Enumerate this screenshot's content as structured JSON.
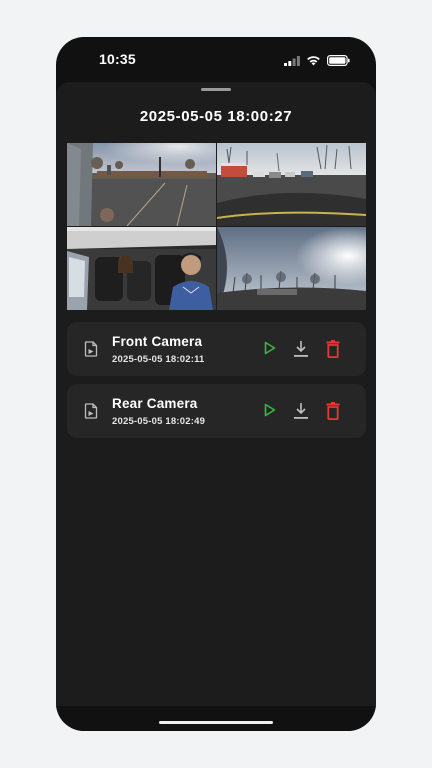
{
  "status_bar": {
    "time": "10:35",
    "icons": [
      "cellular-signal-icon",
      "wifi-icon",
      "battery-icon"
    ]
  },
  "sheet": {
    "title": "2025-05-05 18:00:27",
    "previews": [
      {
        "name": "front-view-preview"
      },
      {
        "name": "rear-view-preview"
      },
      {
        "name": "cabin-view-preview"
      },
      {
        "name": "side-view-preview"
      }
    ]
  },
  "recordings": [
    {
      "label": "Front Camera",
      "timestamp": "2025-05-05 18:02:11",
      "icon": "video-file-icon"
    },
    {
      "label": "Rear Camera",
      "timestamp": "2025-05-05 18:02:49",
      "icon": "video-file-icon"
    }
  ],
  "colors": {
    "play": "#3bb54a",
    "download": "#bdbdbd",
    "delete": "#e53935",
    "card": "#262626",
    "sheet": "#1c1c1c"
  }
}
